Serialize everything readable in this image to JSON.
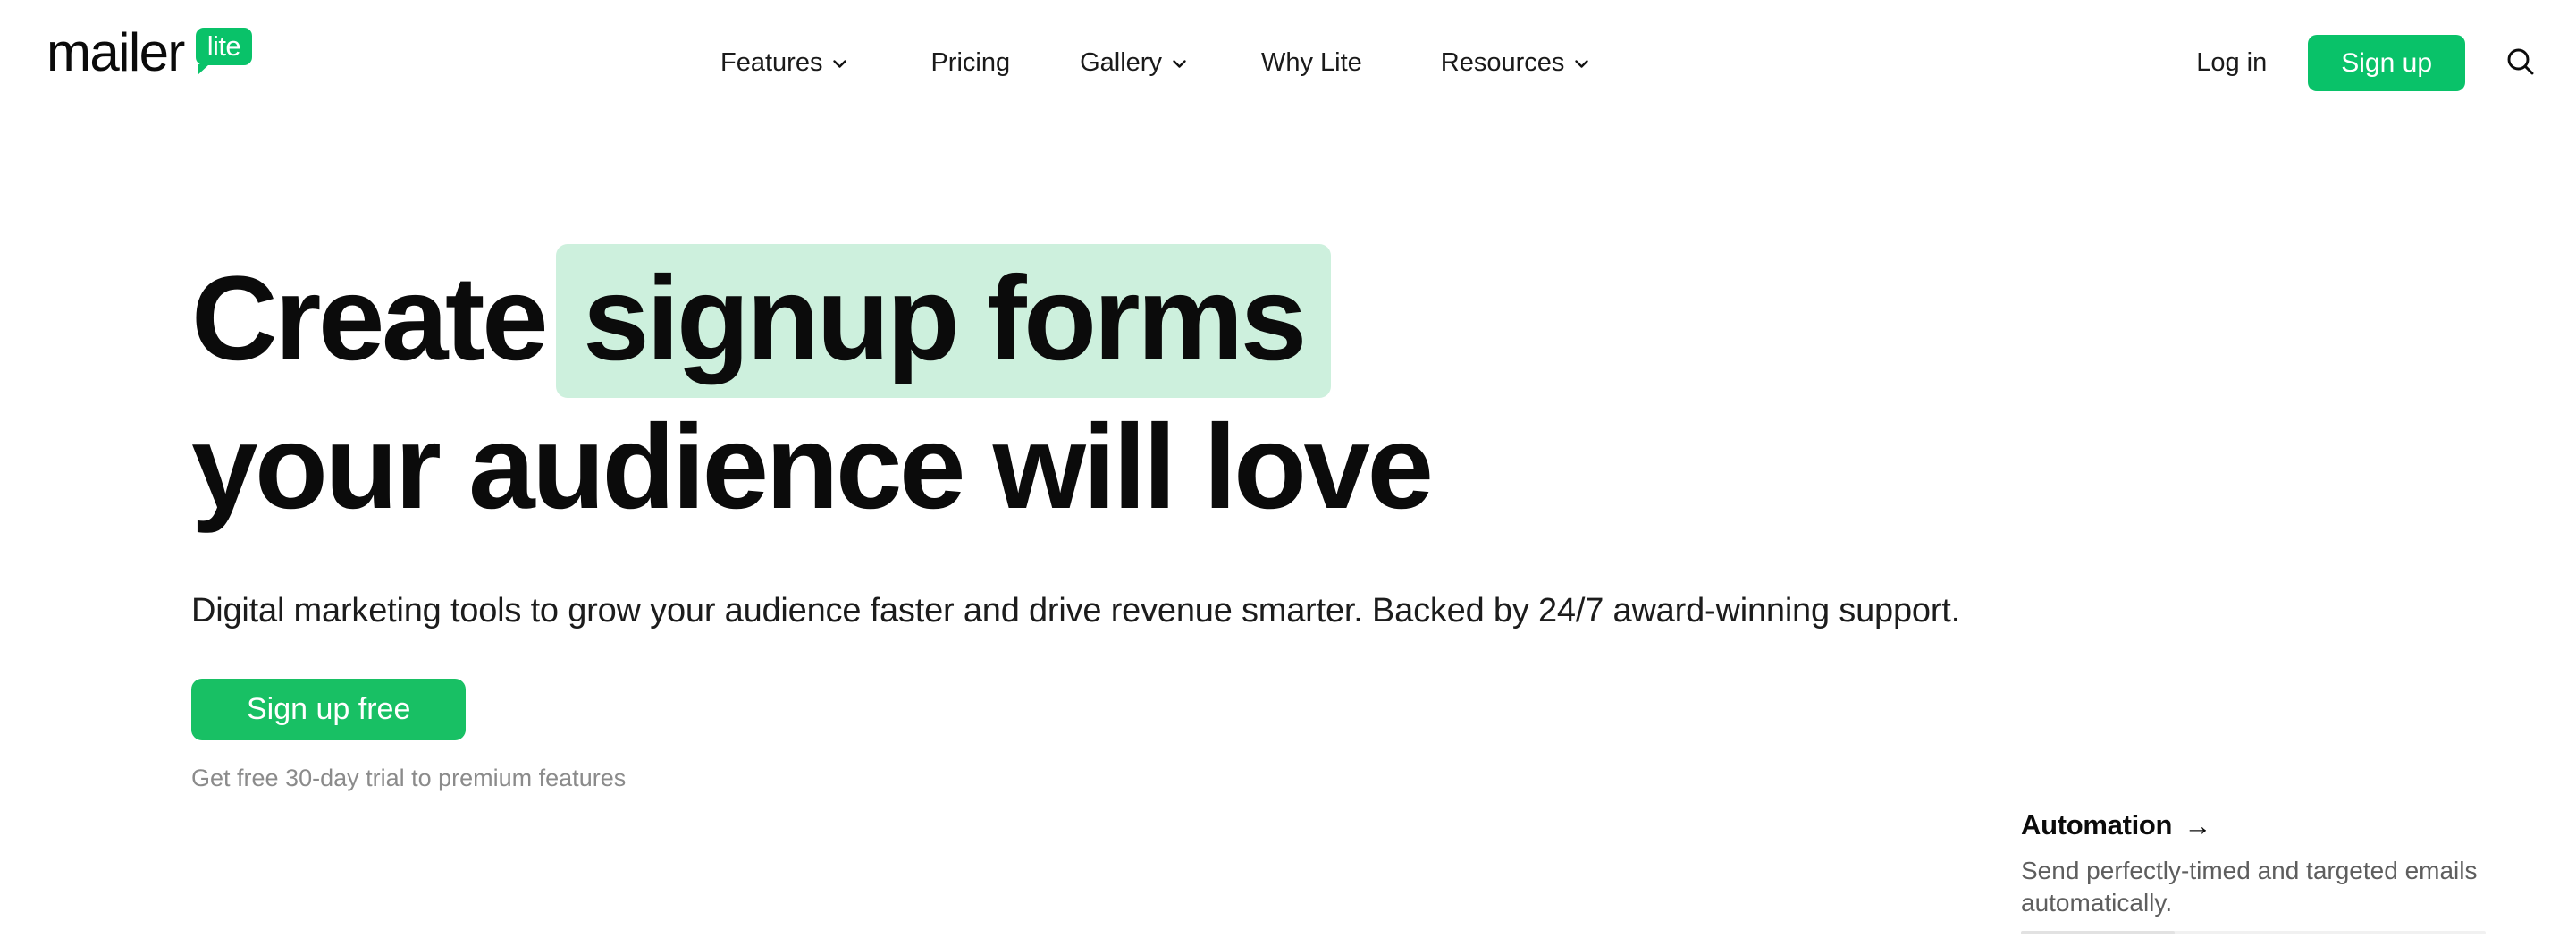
{
  "brand": {
    "logo_word": "mailer",
    "logo_badge": "lite",
    "accent_green": "#09C269",
    "cta_green": "#18C064",
    "highlight_mint": "#CDF0DD",
    "text_black": "#0b0b0b",
    "muted_gray": "#8b8b8b"
  },
  "header": {
    "nav": [
      {
        "label": "Features",
        "has_dropdown": true,
        "icon": "chevron-down-icon"
      },
      {
        "label": "Pricing",
        "has_dropdown": false,
        "icon": ""
      },
      {
        "label": "Gallery",
        "has_dropdown": true,
        "icon": "chevron-down-icon"
      },
      {
        "label": "Why Lite",
        "has_dropdown": false,
        "icon": ""
      },
      {
        "label": "Resources",
        "has_dropdown": true,
        "icon": "chevron-down-icon"
      }
    ],
    "login_label": "Log in",
    "signup_label": "Sign up",
    "search_icon": "search-icon"
  },
  "hero": {
    "title_part1": "Create",
    "title_highlight": "signup forms",
    "title_line2": "your audience will love",
    "subtitle": "Digital marketing tools to grow your audience faster and drive revenue smarter. Backed by 24/7 award-winning support.",
    "cta_label": "Sign up free",
    "note": "Get free 30-day trial to premium features"
  },
  "feature_card": {
    "title": "Automation",
    "arrow": "→",
    "description": "Send perfectly-timed and targeted emails automatically."
  }
}
